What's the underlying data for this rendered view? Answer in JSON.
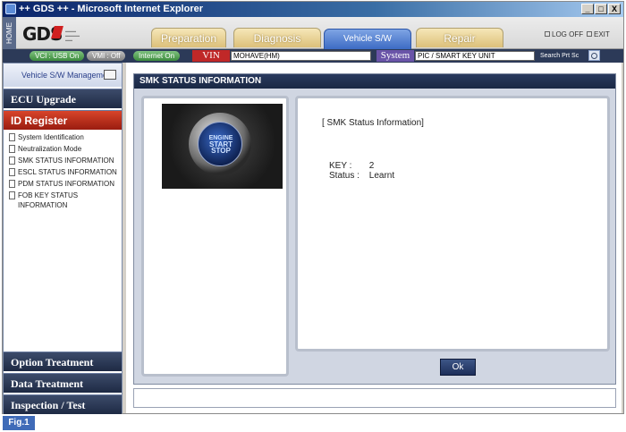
{
  "window": {
    "title": "++ GDS ++ - Microsoft Internet Explorer",
    "controls": [
      "_",
      "□",
      "X"
    ]
  },
  "header": {
    "home_label": "HOME",
    "logo_text": "GDS",
    "tabs": [
      {
        "label": "Preparation",
        "active": false
      },
      {
        "label": "Diagnosis",
        "active": false
      },
      {
        "label": "Vehicle S/W Management",
        "active": true
      },
      {
        "label": "Repair",
        "active": false
      }
    ],
    "logoff_label": "LOG OFF",
    "exit_label": "EXIT"
  },
  "infobar": {
    "vci_status": "VCI : USB On",
    "vmi_status": "VMI : Off",
    "internet_status": "Internet On",
    "vin_label": "VIN",
    "vin_value": "MOHAVE(HM)",
    "system_label": "System",
    "system_value": "PIC / SMART KEY UNIT",
    "search_label": "Search",
    "print_label": "Prt Sc"
  },
  "sidebar": {
    "heading": "Vehicle S/W Management",
    "sections_top": [
      {
        "label": "ECU Upgrade",
        "active": false
      },
      {
        "label": "ID Register",
        "active": true
      }
    ],
    "items": [
      "System Identification",
      "Neutralization Mode",
      "SMK STATUS INFORMATION",
      "ESCL STATUS INFORMATION",
      "PDM STATUS INFORMATION",
      "FOB KEY STATUS INFORMATION"
    ],
    "sections_bottom": [
      {
        "label": "Option Treatment"
      },
      {
        "label": "Data Treatment"
      },
      {
        "label": "Inspection / Test"
      }
    ]
  },
  "panel": {
    "title": "SMK STATUS INFORMATION",
    "image_text": {
      "line1": "ENGINE",
      "line2": "START",
      "line3": "STOP"
    },
    "info_heading": "[ SMK Status Information]",
    "fields": [
      {
        "key": "KEY  :",
        "value": "2"
      },
      {
        "key": "Status :",
        "value": "Learnt"
      }
    ],
    "ok_label": "Ok"
  },
  "figure_label": "Fig.1",
  "colors": {
    "accent_blue": "#3c6bc4",
    "active_section_red": "#c02828",
    "nav_dark": "#1e2a44",
    "vin_red": "#c02828",
    "system_purple": "#6a54a8"
  }
}
